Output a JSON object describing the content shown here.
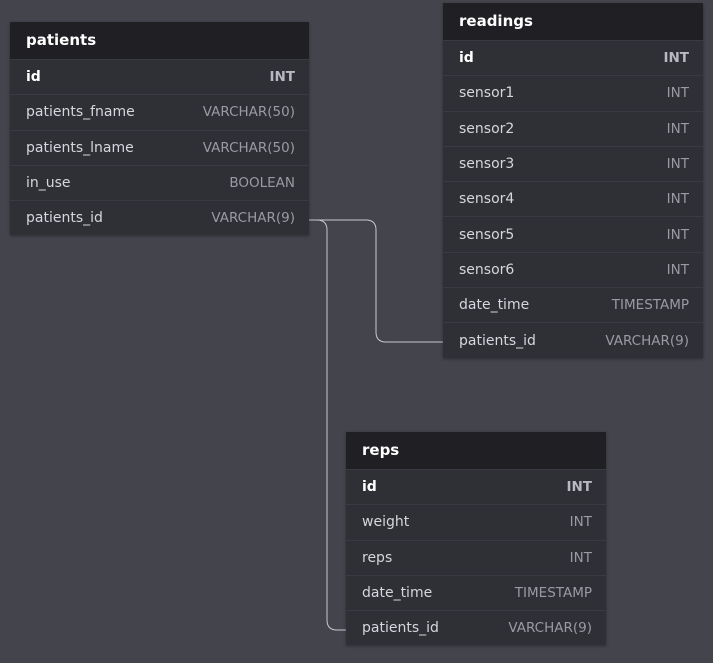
{
  "tables": {
    "patients": {
      "title": "patients",
      "columns": [
        {
          "name": "id",
          "type": "INT",
          "pk": true
        },
        {
          "name": "patients_fname",
          "type": "VARCHAR(50)"
        },
        {
          "name": "patients_lname",
          "type": "VARCHAR(50)"
        },
        {
          "name": "in_use",
          "type": "BOOLEAN"
        },
        {
          "name": "patients_id",
          "type": "VARCHAR(9)"
        }
      ]
    },
    "readings": {
      "title": "readings",
      "columns": [
        {
          "name": "id",
          "type": "INT",
          "pk": true
        },
        {
          "name": "sensor1",
          "type": "INT"
        },
        {
          "name": "sensor2",
          "type": "INT"
        },
        {
          "name": "sensor3",
          "type": "INT"
        },
        {
          "name": "sensor4",
          "type": "INT"
        },
        {
          "name": "sensor5",
          "type": "INT"
        },
        {
          "name": "sensor6",
          "type": "INT"
        },
        {
          "name": "date_time",
          "type": "TIMESTAMP"
        },
        {
          "name": "patients_id",
          "type": "VARCHAR(9)"
        }
      ]
    },
    "reps": {
      "title": "reps",
      "columns": [
        {
          "name": "id",
          "type": "INT",
          "pk": true
        },
        {
          "name": "weight",
          "type": "INT"
        },
        {
          "name": "reps",
          "type": "INT"
        },
        {
          "name": "date_time",
          "type": "TIMESTAMP"
        },
        {
          "name": "patients_id",
          "type": "VARCHAR(9)"
        }
      ]
    }
  },
  "relations": [
    {
      "from": "patients.patients_id",
      "to": "readings.patients_id"
    },
    {
      "from": "patients.patients_id",
      "to": "reps.patients_id"
    }
  ],
  "colors": {
    "background": "#44444d",
    "table_body": "#2f2f36",
    "table_header": "#1f1f24",
    "connector": "#c8c8cc"
  }
}
